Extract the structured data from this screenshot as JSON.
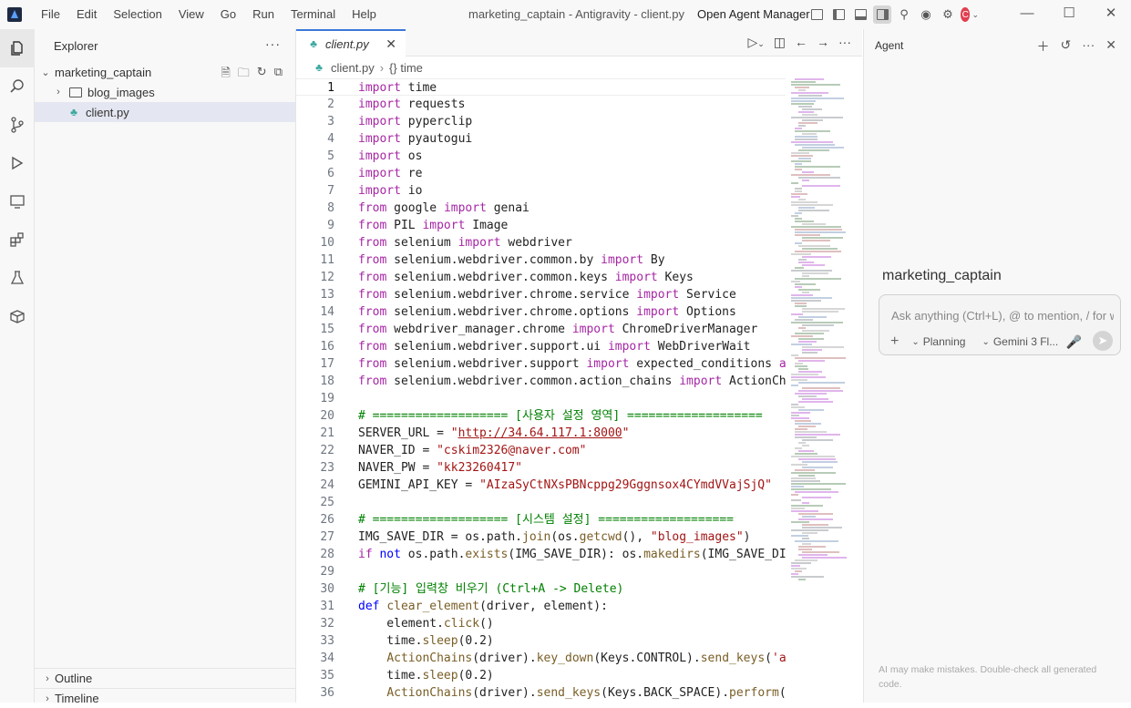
{
  "titlebar": {
    "menu": [
      "File",
      "Edit",
      "Selection",
      "View",
      "Go",
      "Run",
      "Terminal",
      "Help"
    ],
    "title": "marketing_captain - Antigravity - client.py",
    "open_agent_manager": "Open Agent Manager",
    "avatar_letter": "C"
  },
  "sidebar": {
    "header": "Explorer",
    "project": "marketing_captain",
    "folder": "blog_images",
    "file": "client.py",
    "outline": "Outline",
    "timeline": "Timeline"
  },
  "editor": {
    "tab_label": "client.py",
    "breadcrumb_file": "client.py",
    "breadcrumb_symbol": "{} time",
    "lines": [
      "import time",
      "import requests",
      "import pyperclip",
      "import pyautogui",
      "import os",
      "import re",
      "import io",
      "from google import genai",
      "from PIL import Image",
      "from selenium import webdriver",
      "from selenium.webdriver.common.by import By",
      "from selenium.webdriver.common.keys import Keys",
      "from selenium.webdriver.chrome.service import Service",
      "from selenium.webdriver.chrome.options import Options",
      "from webdriver_manager.chrome import ChromeDriverManager",
      "from selenium.webdriver.support.ui import WebDriverWait",
      "from selenium.webdriver.support import expected_conditions as",
      "from selenium.webdriver.common.action_chains import ActionCha",
      "",
      "# =================== [사용자 설정 영역] ===================",
      "SERVER_URL = \"http://34.64.117.1:8000\"",
      "NAVER_ID = \"cskim2326@naver.com\"",
      "NAVER_PW = \"kk23260417\"",
      "GEMINI_API_KEY = \"AIzaSyCtNXsPBNcppg29Gggnsox4CYmdVVajSjQ\"",
      "",
      "# =================== [시스템 설정] ===================",
      "IMG_SAVE_DIR = os.path.join(os.getcwd(), \"blog_images\")",
      "if not os.path.exists(IMG_SAVE_DIR): os.makedirs(IMG_SAVE_DIR",
      "",
      "# [기능] 입력창 비우기 (Ctrl+A -> Delete)",
      "def clear_element(driver, element):",
      "    element.click()",
      "    time.sleep(0.2)",
      "    ActionChains(driver).key_down(Keys.CONTROL).send_keys('a'",
      "    time.sleep(0.2)",
      "    ActionChains(driver).send_keys(Keys.BACK_SPACE).perform()"
    ]
  },
  "agent": {
    "header": "Agent",
    "project_title": "marketing_captain",
    "input_placeholder": "Ask anything (Ctrl+L), @ to mention, / for wo",
    "mode": "Planning",
    "model": "Gemini 3 Fl...",
    "disclaimer": "AI may make mistakes. Double-check all generated code."
  },
  "colors": {
    "accent": "#3c78d8",
    "keyword": "#a626a4",
    "string": "#a31515",
    "comment": "#008000"
  }
}
